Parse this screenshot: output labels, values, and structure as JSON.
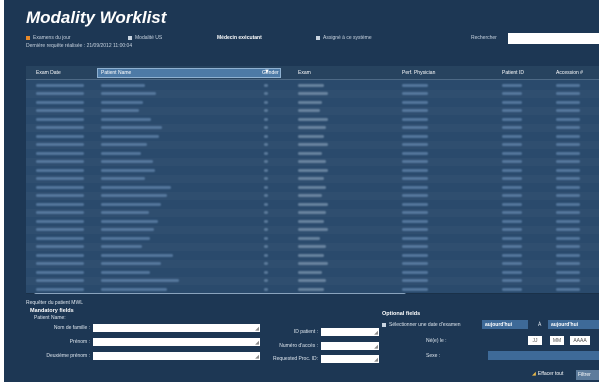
{
  "app": {
    "title": "Modality Worklist"
  },
  "filters": {
    "today": "Examens du jour",
    "modality": "Modalité US",
    "physician": "Médecin exécutant",
    "assigned": "Assigné à ce système",
    "today_color": "#e88a2a"
  },
  "status": {
    "last_request": "Dernière requête réalisée : 21/09/2012 11:00:04"
  },
  "search": {
    "label": "Rechercher",
    "value": ""
  },
  "table": {
    "columns": [
      "Exam Date",
      "Patient Name",
      "Gender",
      "Exam",
      "Perf. Physician",
      "Patient ID",
      "Accession #"
    ],
    "sort_indicator": "▼"
  },
  "query": {
    "title": "Requêter du patient MWL",
    "mandatory": {
      "title": "Mandatory fields",
      "subtitle": "Patient Name:",
      "last_name": "Nom de famille :",
      "first_name": "Prénom :",
      "middle_name": "Deuxième prénom :",
      "patient_id": "ID patient :",
      "accession": "Numéro d'accès :",
      "requested_proc": "Requested Proc. ID:"
    },
    "optional": {
      "title": "Optional fields",
      "date_checkbox": "Sélectionner une date d'examen",
      "date_from": "aujourd'hui",
      "date_to_label": "À",
      "date_to": "aujourd'hui",
      "born_label": "Né(e) le :",
      "dd": "JJ",
      "mm": "MM",
      "yyyy": "AAAA",
      "sex_label": "Sexe :"
    }
  },
  "footer": {
    "show_label": "Effacer tout",
    "cancel_label": "Filtrer"
  }
}
